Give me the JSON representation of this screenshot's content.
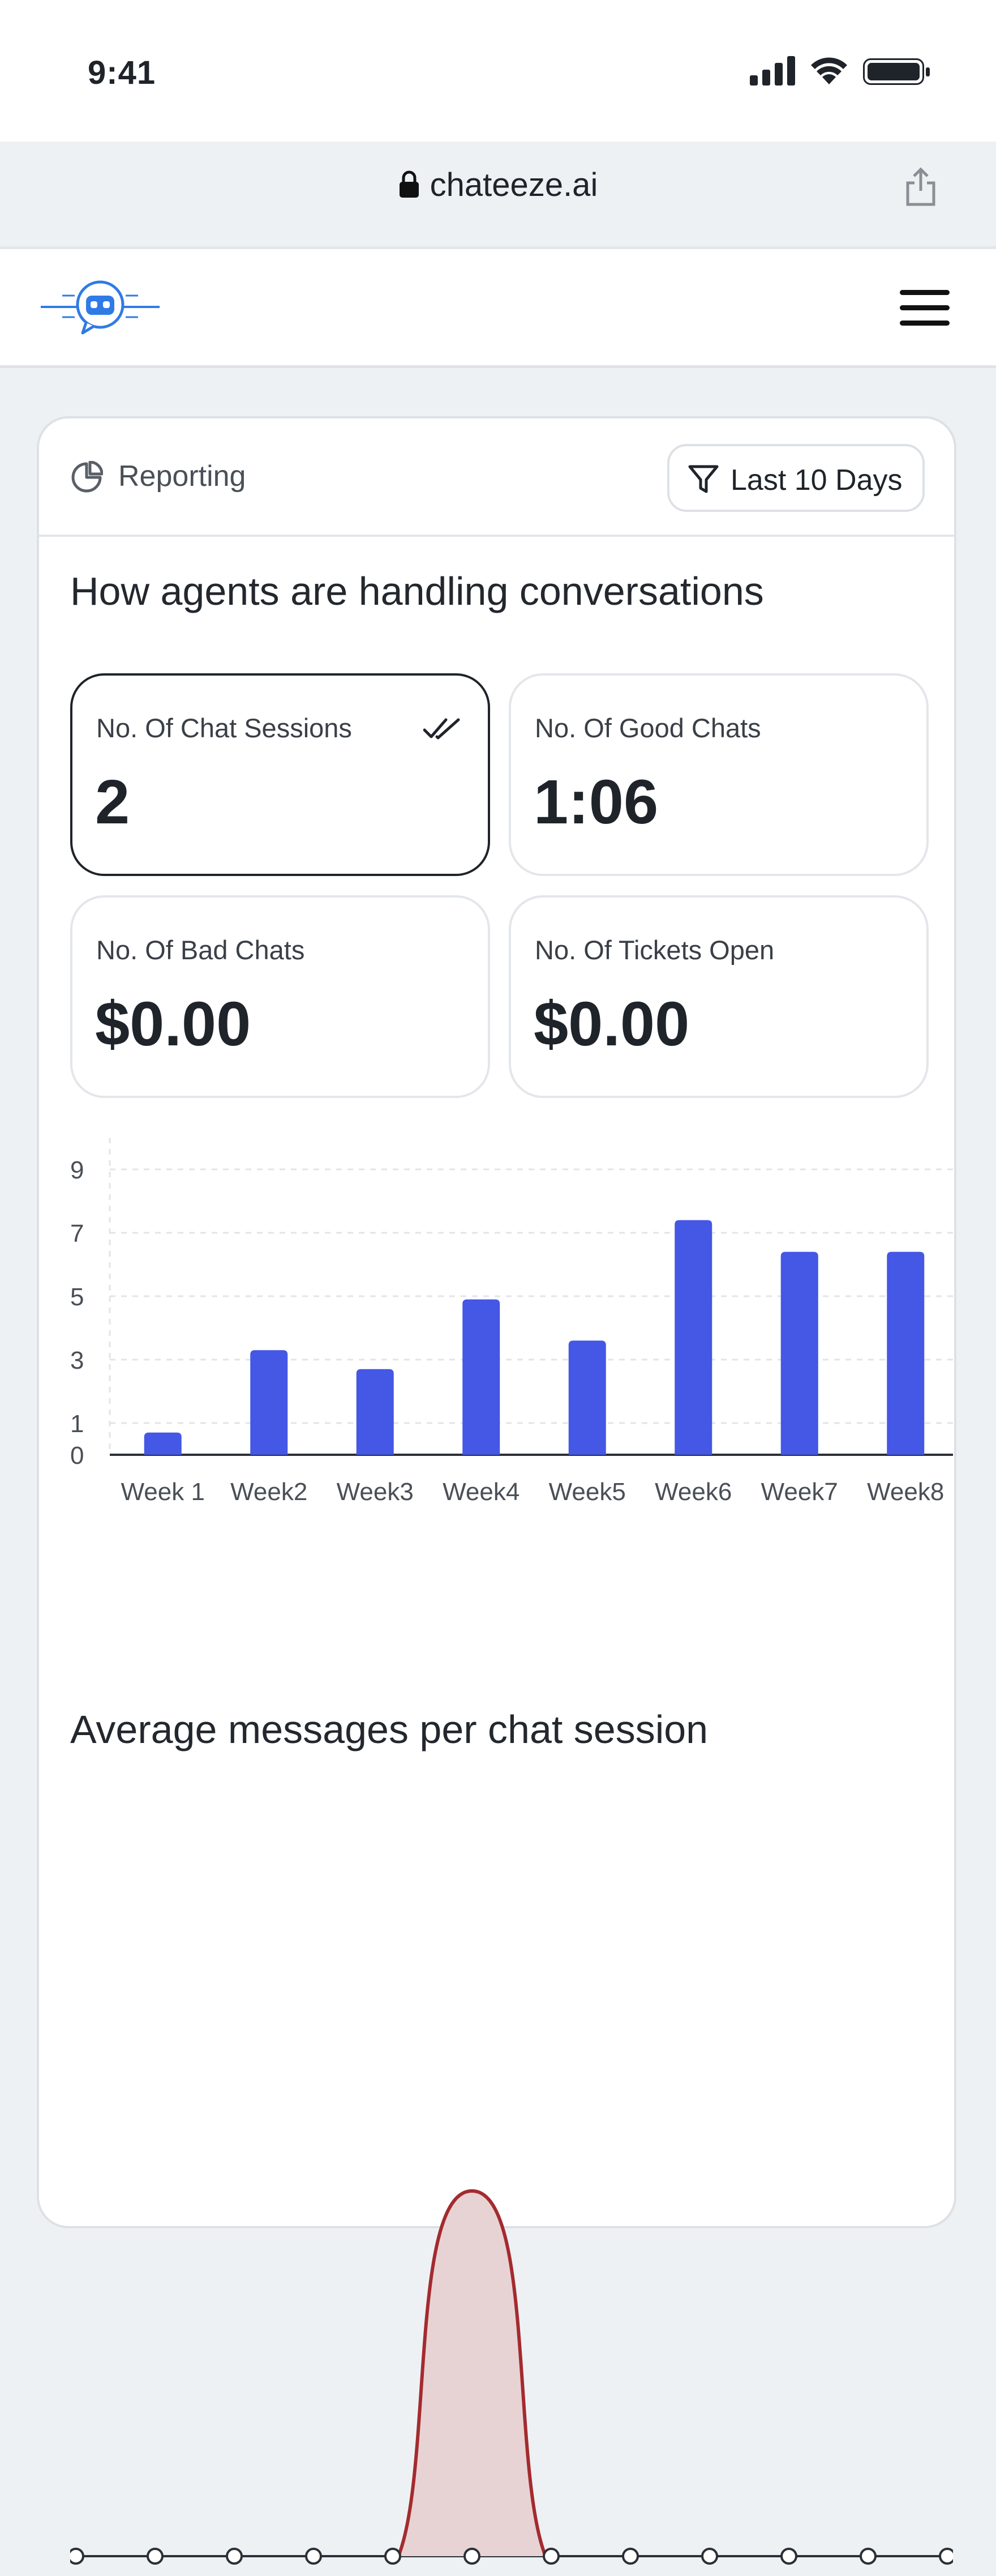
{
  "status_bar": {
    "time": "9:41",
    "icons": [
      "signal-icon",
      "wifi-icon",
      "battery-icon"
    ]
  },
  "browser": {
    "url": "chateeze.ai",
    "lock_icon": "lock-icon",
    "share_icon": "share-icon"
  },
  "nav": {
    "logo_icon": "chat-bot-logo",
    "menu_icon": "hamburger-menu-icon"
  },
  "card": {
    "header": {
      "title": "Reporting",
      "icon": "pie-chart-icon",
      "filter_label": "Last 10 Days",
      "filter_icon": "filter-icon"
    },
    "section_title": "How agents are handling conversations",
    "metrics": [
      {
        "label": "No. Of Chat Sessions",
        "value": "2",
        "selected": true
      },
      {
        "label": "No. Of Good Chats",
        "value": "1:06",
        "selected": false
      },
      {
        "label": "No. Of Bad Chats",
        "value": "$0.00",
        "selected": false
      },
      {
        "label": "No. Of Tickets Open",
        "value": "$0.00",
        "selected": false
      }
    ],
    "avg_title": "Average messages per chat session"
  },
  "colors": {
    "bar": "#4457e5",
    "area_stroke": "#a32b2f",
    "area_fill": "#e8d3d4",
    "text": "#1f232a",
    "accent_blue": "#2f7be5"
  },
  "chart_data": [
    {
      "type": "bar",
      "categories": [
        "Week 1",
        "Week2",
        "Week3",
        "Week4",
        "Week5",
        "Week6",
        "Week7",
        "Week8"
      ],
      "values": [
        0.7,
        3.3,
        2.7,
        4.9,
        3.6,
        7.4,
        6.4,
        6.4
      ],
      "yticks": [
        0,
        1,
        3,
        5,
        7,
        9
      ],
      "ylim": [
        0,
        10
      ],
      "grid": true,
      "xlabel": "",
      "ylabel": "",
      "title": ""
    },
    {
      "type": "area",
      "x": [
        1,
        2,
        3,
        4,
        5,
        6,
        7,
        8,
        9,
        10,
        11,
        12
      ],
      "values": [
        0,
        0,
        0,
        0,
        0,
        1,
        0,
        0,
        0,
        0,
        0,
        0
      ],
      "ylim": [
        0,
        1
      ],
      "xlabel": "",
      "ylabel": "",
      "title": ""
    }
  ]
}
